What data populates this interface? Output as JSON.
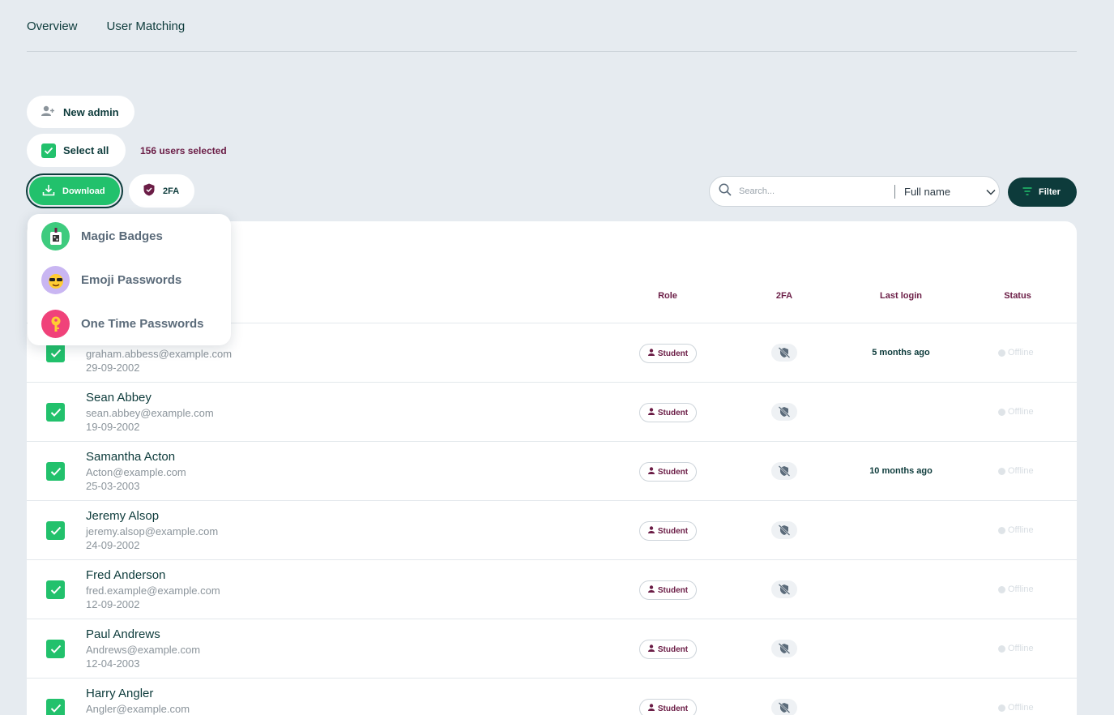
{
  "tabs": [
    "Overview",
    "User Matching"
  ],
  "toolbar": {
    "new_admin": "New admin",
    "select_all": "Select all",
    "selected_count": "156 users selected",
    "download": "Download",
    "twofa": "2FA",
    "filter": "Filter"
  },
  "search": {
    "placeholder": "Search...",
    "field": "Full name"
  },
  "download_menu": [
    "Magic Badges",
    "Emoji Passwords",
    "One Time Passwords"
  ],
  "table": {
    "headers": {
      "role": "Role",
      "twofa": "2FA",
      "last_login": "Last login",
      "status": "Status"
    },
    "rows": [
      {
        "name": "",
        "email": "graham.abbess@example.com",
        "dob": "29-09-2002",
        "role": "Student",
        "last_login": "5 months ago",
        "status": "Offline"
      },
      {
        "name": "Sean Abbey",
        "email": "sean.abbey@example.com",
        "dob": "19-09-2002",
        "role": "Student",
        "last_login": "",
        "status": "Offline"
      },
      {
        "name": "Samantha Acton",
        "email": "Acton@example.com",
        "dob": "25-03-2003",
        "role": "Student",
        "last_login": "10 months ago",
        "status": "Offline"
      },
      {
        "name": "Jeremy Alsop",
        "email": "jeremy.alsop@example.com",
        "dob": "24-09-2002",
        "role": "Student",
        "last_login": "",
        "status": "Offline"
      },
      {
        "name": "Fred Anderson",
        "email": "fred.example@example.com",
        "dob": "12-09-2002",
        "role": "Student",
        "last_login": "",
        "status": "Offline"
      },
      {
        "name": "Paul Andrews",
        "email": "Andrews@example.com",
        "dob": "12-04-2003",
        "role": "Student",
        "last_login": "",
        "status": "Offline"
      },
      {
        "name": "Harry Angler",
        "email": "Angler@example.com",
        "dob": "",
        "role": "Student",
        "last_login": "",
        "status": "Offline"
      }
    ]
  },
  "colors": {
    "accent_green": "#22c16c",
    "dark_teal": "#0d3b3b",
    "maroon": "#6b1d46",
    "background": "#e6ebf0"
  }
}
